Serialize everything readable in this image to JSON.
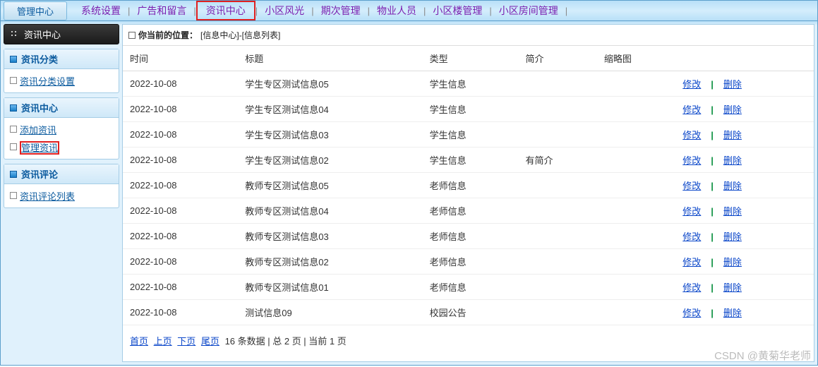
{
  "top": {
    "manage_center": "管理中心",
    "nav": [
      "系统设置",
      "广告和留言",
      "资讯中心",
      "小区风光",
      "期次管理",
      "物业人员",
      "小区楼管理",
      "小区房间管理"
    ],
    "highlight_index": 2
  },
  "sidebar": {
    "header": "资讯中心",
    "boxes": [
      {
        "title": "资讯分类",
        "items": [
          {
            "label": "资讯分类设置"
          }
        ]
      },
      {
        "title": "资讯中心",
        "items": [
          {
            "label": "添加资讯"
          },
          {
            "label": "管理资讯",
            "selected": true
          }
        ]
      },
      {
        "title": "资讯评论",
        "items": [
          {
            "label": "资讯评论列表"
          }
        ]
      }
    ]
  },
  "breadcrumb": {
    "prefix": "你当前的位置：",
    "path": "[信息中心]-[信息列表]"
  },
  "table": {
    "columns": [
      "时间",
      "标题",
      "类型",
      "简介",
      "缩略图",
      ""
    ],
    "rows": [
      {
        "time": "2022-10-08",
        "title": "学生专区测试信息05",
        "type": "学生信息",
        "intro": "",
        "thumb": ""
      },
      {
        "time": "2022-10-08",
        "title": "学生专区测试信息04",
        "type": "学生信息",
        "intro": "",
        "thumb": ""
      },
      {
        "time": "2022-10-08",
        "title": "学生专区测试信息03",
        "type": "学生信息",
        "intro": "",
        "thumb": ""
      },
      {
        "time": "2022-10-08",
        "title": "学生专区测试信息02",
        "type": "学生信息",
        "intro": "有简介",
        "thumb": ""
      },
      {
        "time": "2022-10-08",
        "title": "教师专区测试信息05",
        "type": "老师信息",
        "intro": "",
        "thumb": ""
      },
      {
        "time": "2022-10-08",
        "title": "教师专区测试信息04",
        "type": "老师信息",
        "intro": "",
        "thumb": ""
      },
      {
        "time": "2022-10-08",
        "title": "教师专区测试信息03",
        "type": "老师信息",
        "intro": "",
        "thumb": ""
      },
      {
        "time": "2022-10-08",
        "title": "教师专区测试信息02",
        "type": "老师信息",
        "intro": "",
        "thumb": ""
      },
      {
        "time": "2022-10-08",
        "title": "教师专区测试信息01",
        "type": "老师信息",
        "intro": "",
        "thumb": ""
      },
      {
        "time": "2022-10-08",
        "title": "测试信息09",
        "type": "校园公告",
        "intro": "",
        "thumb": ""
      }
    ],
    "actions": {
      "edit": "修改",
      "delete": "删除"
    }
  },
  "pager": {
    "first": "首页",
    "prev": "上页",
    "next": "下页",
    "last": "尾页",
    "summary": "16 条数据 | 总 2 页 | 当前 1 页"
  },
  "watermark": "CSDN @黄菊华老师"
}
